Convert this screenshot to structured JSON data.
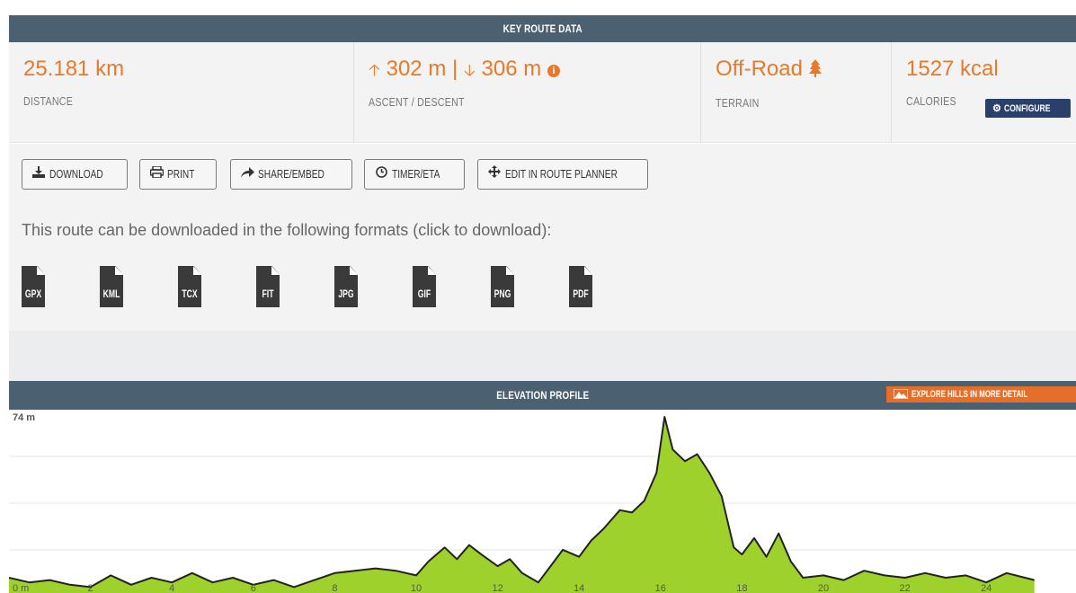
{
  "key_route_data": {
    "title": "KEY ROUTE DATA",
    "distance": {
      "value": "25.181 km",
      "label": "DISTANCE"
    },
    "ascent_descent": {
      "ascent": "302 m",
      "separator": "|",
      "descent": "306 m",
      "label": "ASCENT / DESCENT"
    },
    "terrain": {
      "value": "Off-Road",
      "label": "TERRAIN"
    },
    "calories": {
      "value": "1527 kcal",
      "label": "CALORIES",
      "configure_label": "CONFIGURE"
    }
  },
  "actions": {
    "download": "DOWNLOAD",
    "print": "PRINT",
    "share": "SHARE/EMBED",
    "timer": "TIMER/ETA",
    "edit": "EDIT IN ROUTE PLANNER"
  },
  "formats": {
    "intro": "This route can be downloaded in the following formats (click to download):",
    "list": [
      "GPX",
      "KML",
      "TCX",
      "FIT",
      "JPG",
      "GIF",
      "PNG",
      "PDF"
    ]
  },
  "elevation": {
    "title": "ELEVATION PROFILE",
    "explore_label": "EXPLORE HILLS IN MORE DETAIL",
    "fill_color": "#9fd12c",
    "line_color": "#222222"
  },
  "chart_data": {
    "type": "area",
    "ylabel_top": "74 m",
    "x_ticks": [
      "0 m",
      "2",
      "4",
      "6",
      "8",
      "10",
      "12",
      "14",
      "16",
      "18",
      "20",
      "22",
      "24"
    ],
    "x_unit": "km",
    "ymax": 74,
    "x": [
      0,
      0.5,
      1,
      1.5,
      2,
      2.5,
      3,
      3.5,
      4,
      4.5,
      5,
      5.5,
      6,
      6.5,
      7,
      7.5,
      8,
      8.5,
      9,
      9.5,
      10,
      10.3,
      10.7,
      11,
      11.3,
      11.6,
      12,
      12.3,
      12.6,
      13,
      13.3,
      13.6,
      14,
      14.3,
      14.6,
      15,
      15.3,
      15.6,
      15.9,
      16.1,
      16.3,
      16.6,
      16.9,
      17.2,
      17.5,
      17.8,
      18,
      18.3,
      18.6,
      18.9,
      19.2,
      19.5,
      20,
      20.5,
      21,
      21.5,
      22,
      22.5,
      23,
      23.5,
      24,
      24.5,
      25.181
    ],
    "y": [
      5,
      3,
      4,
      2,
      1,
      6,
      2,
      5,
      3,
      7,
      3,
      5,
      2,
      4,
      1,
      4,
      7,
      8,
      9,
      8,
      6,
      12,
      18,
      13,
      19,
      15,
      10,
      13,
      7,
      3,
      10,
      17,
      14,
      21,
      26,
      34,
      33,
      38,
      50,
      74,
      60,
      55,
      58,
      50,
      40,
      18,
      15,
      22,
      14,
      24,
      12,
      5,
      6,
      4,
      8,
      6,
      5,
      7,
      5,
      6,
      3,
      7,
      4
    ]
  }
}
